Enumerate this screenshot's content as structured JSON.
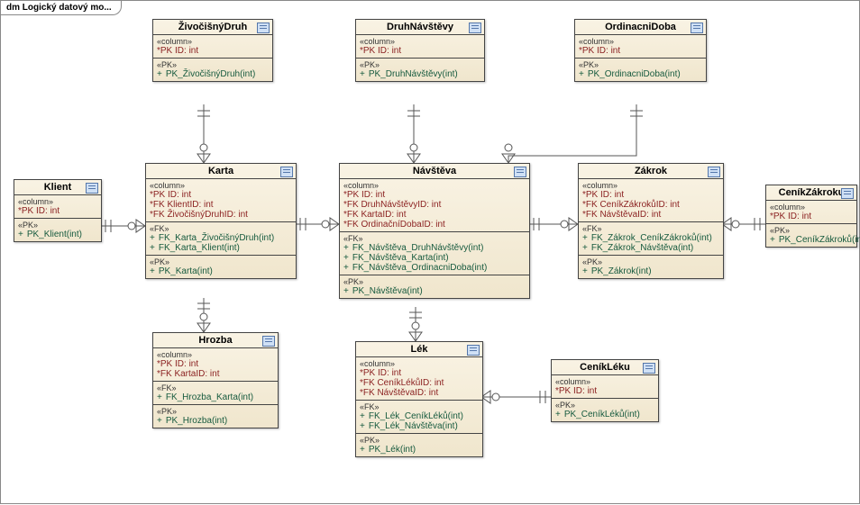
{
  "diagram": {
    "title": "dm Logický datový mo...",
    "stereotypes": {
      "column": "«column»",
      "pk": "«PK»",
      "fk": "«FK»"
    }
  },
  "entities": {
    "klient": {
      "name": "Klient",
      "cols": [
        "*PK ID: int"
      ],
      "pks": [
        "PK_Klient(int)"
      ]
    },
    "zivocisnyDruh": {
      "name": "ŽivočišnýDruh",
      "cols": [
        "*PK ID: int"
      ],
      "pks": [
        "PK_ŽivočišnýDruh(int)"
      ]
    },
    "druhNavstevy": {
      "name": "DruhNávštěvy",
      "cols": [
        "*PK ID: int"
      ],
      "pks": [
        "PK_DruhNávštěvy(int)"
      ]
    },
    "ordinacniDoba": {
      "name": "OrdinacniDoba",
      "cols": [
        "*PK ID: int"
      ],
      "pks": [
        "PK_OrdinacniDoba(int)"
      ]
    },
    "cenikZakroku": {
      "name": "CeníkZákroku",
      "cols": [
        "*PK ID: int"
      ],
      "pks": [
        "PK_CeníkZákroků(int)"
      ]
    },
    "cenikLeku": {
      "name": "CeníkLéku",
      "cols": [
        "*PK ID: int"
      ],
      "pks": [
        "PK_CeníkLéků(int)"
      ]
    },
    "karta": {
      "name": "Karta",
      "cols": [
        "*PK ID: int",
        "*FK KlientID: int",
        "*FK ŽivočišnýDruhID: int"
      ],
      "fks": [
        "FK_Karta_ŽivočišnýDruh(int)",
        "FK_Karta_Klient(int)"
      ],
      "pks": [
        "PK_Karta(int)"
      ]
    },
    "navsteva": {
      "name": "Návštěva",
      "cols": [
        "*PK ID: int",
        "*FK DruhNávštěvyID: int",
        "*FK KartaID: int",
        "*FK OrdinačníDobaID: int"
      ],
      "fks": [
        "FK_Návštěva_DruhNávštěvy(int)",
        "FK_Návštěva_Karta(int)",
        "FK_Návštěva_OrdinacniDoba(int)"
      ],
      "pks": [
        "PK_Návštěva(int)"
      ]
    },
    "zakrok": {
      "name": "Zákrok",
      "cols": [
        "*PK ID: int",
        "*FK CeníkZákrokůID: int",
        "*FK NávštěvaID: int"
      ],
      "fks": [
        "FK_Zákrok_CeníkZákroků(int)",
        "FK_Zákrok_Návštěva(int)"
      ],
      "pks": [
        "PK_Zákrok(int)"
      ]
    },
    "hrozba": {
      "name": "Hrozba",
      "cols": [
        "*PK ID: int",
        "*FK KartaID: int"
      ],
      "fks": [
        "FK_Hrozba_Karta(int)"
      ],
      "pks": [
        "PK_Hrozba(int)"
      ]
    },
    "lek": {
      "name": "Lék",
      "cols": [
        "*PK ID: int",
        "*FK CeníkLékůID: int",
        "*FK NávštěvaID: int"
      ],
      "fks": [
        "FK_Lék_CeníkLéků(int)",
        "FK_Lék_Návštěva(int)"
      ],
      "pks": [
        "PK_Lék(int)"
      ]
    }
  }
}
